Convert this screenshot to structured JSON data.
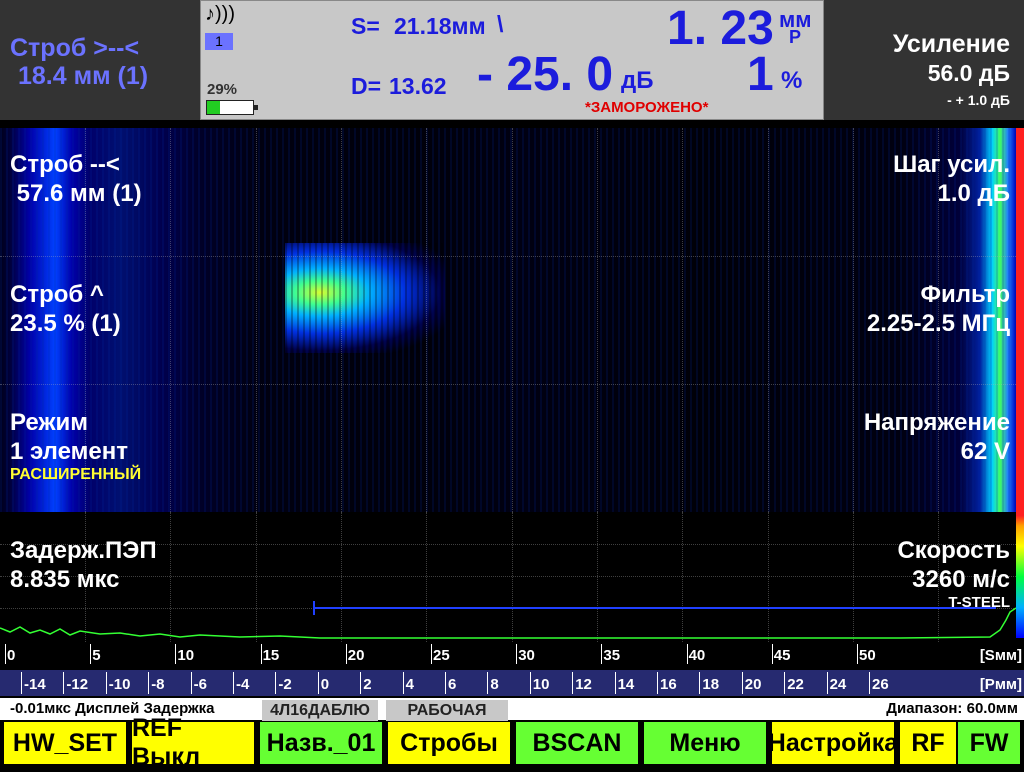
{
  "header": {
    "gate_left_line1": "Строб >--<",
    "gate_left_line2": "18.4 мм (1)",
    "gate_number": "1",
    "battery_percent": "29%",
    "battery_level": 0.29,
    "s_label": "S=",
    "s_value": "21.18мм",
    "s_sep": "\\",
    "d_label": "D=",
    "d_value": "13.62",
    "db_value": "- 25. 0",
    "db_unit": "дБ",
    "depth_value": "1. 23",
    "depth_unit": "мм",
    "depth_sub": "Р",
    "percent_value": "1",
    "percent_unit": "%",
    "frozen": "*ЗАМОРОЖЕНО*",
    "gain_label": "Усиление",
    "gain_value": "56.0 дБ",
    "gain_step": "- + 1.0 дБ"
  },
  "overlays": {
    "left": [
      {
        "line1": "Строб --<",
        "line2": " 57.6 мм (1)"
      },
      {
        "line1": "Строб ^",
        "line2": "23.5 % (1)"
      },
      {
        "line1": "Режим",
        "line2": "1 элемент",
        "line3": "РАСШИРЕННЫЙ"
      },
      {
        "line1": "Задерж.ПЭП",
        "line2": "8.835 мкс"
      }
    ],
    "right": [
      {
        "line1": "Шаг усил.",
        "line2": "1.0 дБ"
      },
      {
        "line1": "Фильтр",
        "line2": "2.25-2.5 МГц"
      },
      {
        "line1": "Напряжение",
        "line2": "62 V"
      },
      {
        "line1": "Скорость",
        "line2": "3260 м/с",
        "line3": "T-STEEL"
      }
    ]
  },
  "ruler_s": {
    "ticks": [
      "0",
      "5",
      "10",
      "15",
      "20",
      "25",
      "30",
      "35",
      "40",
      "45",
      "50"
    ],
    "unit": "[Sмм]"
  },
  "ruler_p": {
    "ticks": [
      "-14",
      "-12",
      "-10",
      "-8",
      "-6",
      "-4",
      "-2",
      "0",
      "2",
      "4",
      "6",
      "8",
      "10",
      "12",
      "14",
      "16",
      "18",
      "20",
      "22",
      "24",
      "26"
    ],
    "unit": "[Pмм]"
  },
  "info_bar": {
    "delay": "-0.01мкс  Дисплей Задержка",
    "tab1": "4Л16ДАБЛЮ",
    "tab2": "РАБОЧАЯ",
    "range": "Диапазон:  60.0мм"
  },
  "buttons": [
    "HW_SET",
    "REF Выкл",
    "Назв._01",
    "Стробы",
    "BSCAN",
    "Меню",
    "Настройка",
    "RF",
    "FW"
  ],
  "colors": {
    "accent_blue": "#1c1cdc",
    "button_yellow": "#ffff00",
    "button_green": "#66ff33",
    "frozen_red": "#e00000"
  }
}
